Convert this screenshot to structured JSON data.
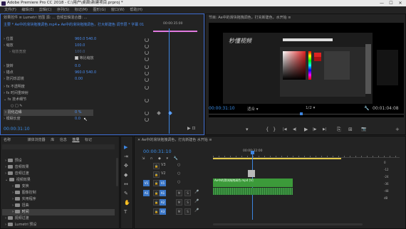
{
  "title_bar": {
    "app_title": "Adobe Premiere Pro CC 2018 - C:\\用户\\桌面\\新建项目.prproj *",
    "minimize": "—",
    "maximize": "☐",
    "close": "✕"
  },
  "menu": [
    "文件(F)",
    "编辑(E)",
    "剪辑(C)",
    "序列(S)",
    "标记(M)",
    "图形(G)",
    "窗口(W)",
    "帮助(H)"
  ],
  "effect_controls": {
    "tab": "效果控件 ≡   Lumetri 范围   源: ...   音频剪辑混合器: ...",
    "clip_path": "主要 * Ae中的滑块拖拽调色.mp4 ▸ Ae中的滑块拖拽调色，打大新建色 调节层 * 字幕 01",
    "time_ruler": "00:00:35:00",
    "rows": [
      {
        "label": "位置",
        "value": "960.0  540.0"
      },
      {
        "label": "缩放",
        "value": "100.0"
      },
      {
        "label": "缩放宽度",
        "value": "100.0"
      },
      {
        "label": "等比缩放",
        "value": ""
      },
      {
        "label": "旋转",
        "value": "0.0"
      },
      {
        "label": "锚点",
        "value": "960.0  540.0"
      },
      {
        "label": "防闪烁滤镜",
        "value": "0.00"
      },
      {
        "label": "不透明度",
        "value": ""
      },
      {
        "label": "时间重映射",
        "value": ""
      },
      {
        "label": "技术细节",
        "value": ""
      },
      {
        "label": "",
        "value": ""
      },
      {
        "label": "羽化边缘",
        "value": "0 %"
      },
      {
        "label": "模糊长度",
        "value": "0.0"
      }
    ],
    "uniform_scale_label": "等比缩放",
    "timecode": "00:00:31:10"
  },
  "program_monitor": {
    "tab": "节目: Ae中的滑块拖拽调色，打充新建色，水开始 ≡",
    "timecode": "00:00:31:10",
    "fit": "适合",
    "quality": "1/2",
    "duration": "00:01:04:08",
    "watermark_logo": "秒懂视频",
    "watermark_logo_small": "秒懂视频"
  },
  "project_panel": {
    "tabs": [
      "名称",
      "媒体浏览器",
      "库",
      "信息",
      "效果",
      "标记"
    ],
    "items": [
      {
        "name": "预设",
        "indent": 1
      },
      {
        "name": "音频效果",
        "indent": 1
      },
      {
        "name": "音频过渡",
        "indent": 1
      },
      {
        "name": "视频效果",
        "indent": 1
      },
      {
        "name": "变换",
        "indent": 2
      },
      {
        "name": "图像控制",
        "indent": 2
      },
      {
        "name": "实用程序",
        "indent": 2
      },
      {
        "name": "扭曲",
        "indent": 2
      },
      {
        "name": "时间",
        "indent": 2
      },
      {
        "name": "视频过渡",
        "indent": 1
      },
      {
        "name": "Lumetri 预设",
        "indent": 1
      }
    ]
  },
  "timeline": {
    "tab": "Ae中的滑块拖拽调色，打充新建色 水开始 ≡",
    "timecode": "00:00:31:10",
    "ruler_time": "00:00:32:00",
    "video_tracks": [
      "V3",
      "V2",
      "V1"
    ],
    "audio_tracks": [
      "A1",
      "A2",
      "A3"
    ],
    "clip_v1": "Ae中的滑块拖拽调色.mp4 [V]",
    "clip_v1b": "Ae中的滑块拖拽调色.mp4",
    "track_controls": {
      "toggle": "○",
      "lock": "🔒",
      "m": "M",
      "s": "S",
      "mic": "🎤"
    }
  },
  "tools": {
    "select": "▶",
    "track_select": "⇥",
    "ripple": "✥",
    "razor": "◆",
    "slip": "↔",
    "pen": "✎",
    "hand": "✋",
    "text": "T"
  },
  "transport": {
    "marker": "▾",
    "in": "{",
    "out": "}",
    "prev_edit": "|◀",
    "step_back": "◀|",
    "play": "▶",
    "step_fwd": "|▶",
    "next_edit": "▶|",
    "lift": "⎘",
    "extract": "⊞",
    "camera": "📷",
    "settings": "+",
    "wrench": "🔧"
  },
  "colors": {
    "accent": "#3d6cd1",
    "clip_green": "#3c9a3a",
    "playhead": "#3d85e0",
    "timecode_blue": "#3a8eea",
    "pink_bar": "#e07adf"
  }
}
